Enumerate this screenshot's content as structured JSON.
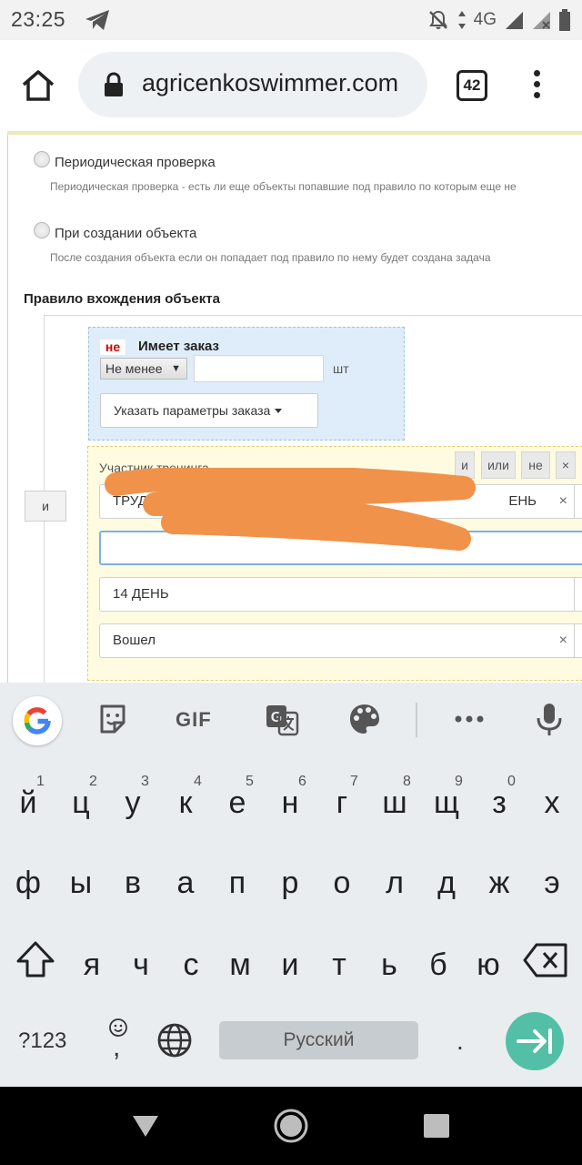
{
  "status_bar": {
    "time": "23:25",
    "network": "4G",
    "icons": [
      "telegram-icon",
      "mute-icon",
      "signal-icon",
      "signal-no-data-icon",
      "battery-icon"
    ]
  },
  "browser": {
    "url": "agricenkoswimmer.com",
    "tab_count": "42",
    "icons": [
      "home-icon",
      "lock-icon",
      "tabs-icon",
      "menu-icon"
    ]
  },
  "page": {
    "radio_periodic": {
      "label": "Периодическая проверка",
      "description": "Периодическая проверка - есть ли еще объекты попавшие под правило по которым еще не"
    },
    "radio_create": {
      "label": "При создании объекта",
      "description": "После создания объекта если он попадает под правило по нему будет создана задача"
    },
    "section_title": "Правило вхождения объекта",
    "and_button": "и",
    "order_block": {
      "negation": "не",
      "title": "Имеет заказ",
      "min_select": "Не менее",
      "quantity_value": "",
      "unit": "шт",
      "params_button": "Указать параметры заказа"
    },
    "participant_block": {
      "title": "Участник тренинга",
      "logic_buttons": [
        "и",
        "или",
        "не",
        "×"
      ],
      "select_1_prefix": "ТРУД",
      "select_1_suffix": "ЕНЬ",
      "select_2": "14 ДЕНЬ",
      "select_3": "Вошел",
      "clear_symbol": "×",
      "arrow_symbol": "▾"
    }
  },
  "keyboard": {
    "toolbar": {
      "gif": "GIF",
      "icons": [
        "google-icon",
        "sticker-icon",
        "translate-icon",
        "palette-icon",
        "more-icon",
        "mic-icon"
      ]
    },
    "rows": [
      [
        "й",
        "ц",
        "у",
        "к",
        "е",
        "н",
        "г",
        "ш",
        "щ",
        "з",
        "х"
      ],
      [
        "ф",
        "ы",
        "в",
        "а",
        "п",
        "р",
        "о",
        "л",
        "д",
        "ж",
        "э"
      ],
      [
        "я",
        "ч",
        "с",
        "м",
        "и",
        "т",
        "ь",
        "б",
        "ю"
      ]
    ],
    "number_hints": [
      "1",
      "2",
      "3",
      "4",
      "5",
      "6",
      "7",
      "8",
      "9",
      "0"
    ],
    "symbols_key": "?123",
    "comma_key": ",",
    "space_label": "Русский",
    "period_key": "."
  },
  "colors": {
    "accent_enter": "#53bfa7",
    "order_bg": "#deedf9",
    "participant_bg": "#fffbe0",
    "negation_red": "#d40000",
    "redaction": "#f0924a"
  }
}
